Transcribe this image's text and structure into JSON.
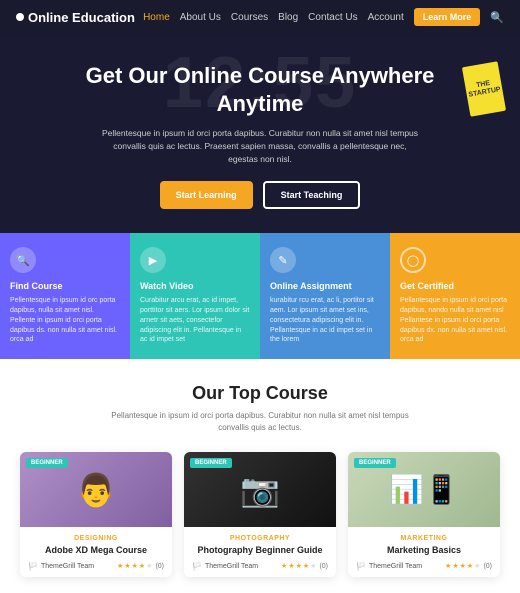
{
  "brand": {
    "name": "Online Education",
    "logo_dot": "●"
  },
  "nav": {
    "links": [
      {
        "label": "Home",
        "active": true
      },
      {
        "label": "About Us",
        "active": false
      },
      {
        "label": "Courses",
        "active": false
      },
      {
        "label": "Blog",
        "active": false
      },
      {
        "label": "Contact Us",
        "active": false
      },
      {
        "label": "Account",
        "active": false
      }
    ],
    "cta": "Learn More",
    "search_icon": "🔍"
  },
  "hero": {
    "bg_text": "12:55",
    "heading": "Get Our Online Course Anywhere Anytime",
    "description": "Pellentesque in ipsum id orci porta dapibus. Curabitur non nulla sit amet nisl tempus convallis quis ac lectus. Praesent sapien massa, convallis a pellentesque nec, egestas non nisl.",
    "btn_primary": "Start Learning",
    "btn_secondary": "Start Teaching"
  },
  "features": [
    {
      "icon": "🔍",
      "title": "Find Course",
      "desc": "Pellentesque in ipsum id orc porta dapibus, nulla sit amet nisl. Pellente in ipsum id orci porta dapibus ds. non nulla sit amet nisl. orca ad"
    },
    {
      "icon": "▶",
      "title": "Watch Video",
      "desc": "Curabitur arcu erat, ac id impet, porttitor sit aers. Lor ipsum dolor sit arnetr sit aets, consectefor adipiscing elit in. Pellantesque in ac id impet set"
    },
    {
      "icon": "✎",
      "title": "Online Assignment",
      "desc": "kurabitur rcu erat, ac li, portitor sit aem. Lor ipsum sit amet set ins, consectetura adipiscing elit in. Pellantesque in ac id impet set in the lorem"
    },
    {
      "icon": "◯",
      "title": "Get Certified",
      "desc": "Pellantesque in ipsum id orci porta dapibus, nando nulla sit amet nisl Pellantese in ipsum id orci porta dapibus dx. non nulla sit amet nisl. orca ad"
    }
  ],
  "top_course": {
    "heading": "Our Top Course",
    "subtitle": "Pellantesque in ipsum id orci porta dapibus. Curabitur non nulla sit amet nisl tempus convallis quis ac lectus."
  },
  "courses": [
    {
      "badge": "Beginner",
      "category": "Designing",
      "title": "Adobe XD Mega Course",
      "team": "ThemeGrill Team",
      "rating": 4,
      "total_stars": 5,
      "reviews": "(0)",
      "bg_color": "#c8b8d0",
      "emoji": "👨"
    },
    {
      "badge": "Beginner",
      "category": "Photography",
      "title": "Photography Beginner Guide",
      "team": "ThemeGrill Team",
      "rating": 4,
      "total_stars": 5,
      "reviews": "(0)",
      "bg_color": "#2a2a2a",
      "emoji": "📷"
    },
    {
      "badge": "Beginner",
      "category": "Marketing",
      "title": "Marketing Basics",
      "team": "ThemeGrill Team",
      "rating": 4,
      "total_stars": 5,
      "reviews": "(0)",
      "bg_color": "#d4e0c8",
      "emoji": "📊"
    }
  ]
}
